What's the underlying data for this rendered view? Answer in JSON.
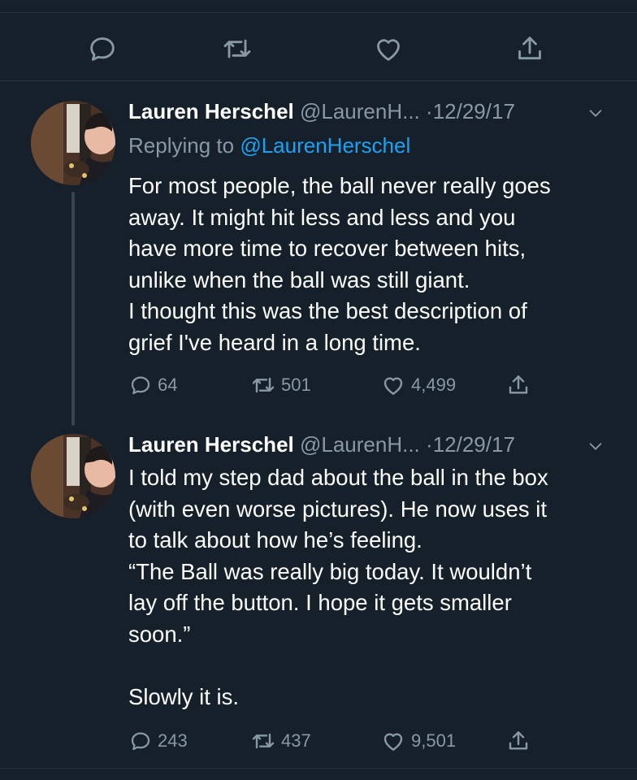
{
  "colors": {
    "background": "#15202b",
    "text": "#ffffff",
    "muted": "#8899a6",
    "accent": "#1da1f2"
  },
  "top_actions": [
    {
      "icon": "reply-icon"
    },
    {
      "icon": "retweet-icon"
    },
    {
      "icon": "like-icon"
    },
    {
      "icon": "share-icon"
    }
  ],
  "tweets": [
    {
      "name": "Lauren Herschel",
      "handle": "@LaurenH...",
      "dot": "·",
      "date": "12/29/17",
      "reply_prefix": "Replying to",
      "reply_mention": "@LaurenHerschel",
      "text": "For most people, the ball never really goes\naway. It might hit less and less and you\nhave more time to recover between hits,\nunlike when the ball was still giant.\nI thought this was the best description of\ngrief I've heard in a long time.",
      "replies": "64",
      "retweets": "501",
      "likes": "4,499"
    },
    {
      "name": "Lauren Herschel",
      "handle": "@LaurenH...",
      "dot": "·",
      "date": "12/29/17",
      "text": "I told my step dad about the ball in the box\n(with even worse pictures). He now uses it\nto talk about how he’s feeling.\n“The Ball was really big today. It wouldn’t\nlay off the button. I hope it gets smaller\nsoon.”\n\nSlowly it is.",
      "replies": "243",
      "retweets": "437",
      "likes": "9,501"
    }
  ]
}
